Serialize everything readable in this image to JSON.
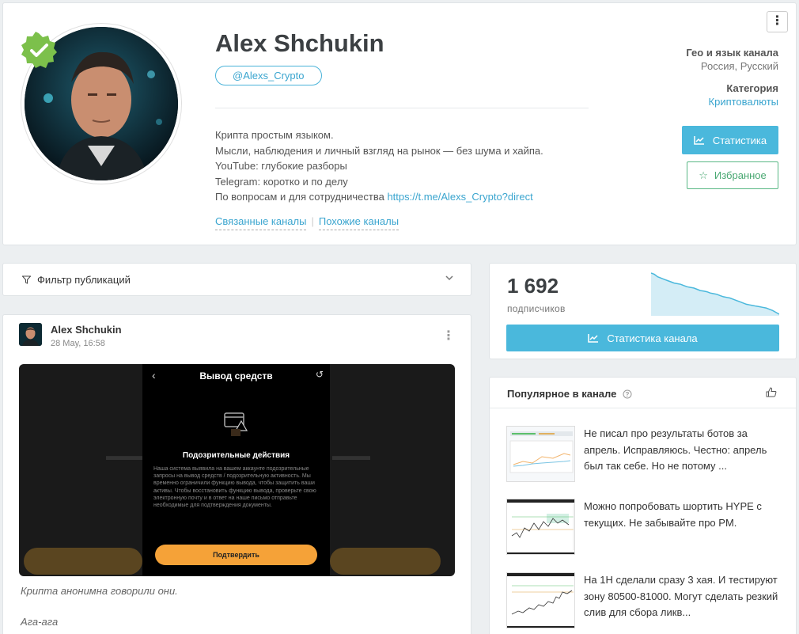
{
  "channel": {
    "name": "Alex Shchukin",
    "handle": "@Alexs_Crypto",
    "description": [
      "Крипта простым языком.",
      "Мысли, наблюдения и личный взгляд на рынок — без шума и хайпа.",
      "YouTube: глубокие разборы",
      "Telegram: коротко и по делу"
    ],
    "contact_text": "По вопросам и для сотрудничества",
    "contact_link": "https://t.me/Alexs_Crypto?direct",
    "related_link": "Связанные каналы",
    "similar_link": "Похожие каналы",
    "menu_icon": "⋮"
  },
  "meta": {
    "geo_label": "Гео и язык канала",
    "geo_value": "Россия, Русский",
    "category_label": "Категория",
    "category_value": "Криптовалюты",
    "stats_button": "Статистика",
    "favorite_button": "Избранное"
  },
  "filter": {
    "label": "Фильтр публикаций"
  },
  "post": {
    "author": "Alex Shchukin",
    "date": "28 May, 16:58",
    "caption": "Крипта анонимна говорили они.",
    "caption2": "Ага-ага",
    "screenshot": {
      "title": "Вывод средств",
      "heading": "Подозрительные действия",
      "body": "Наша система выявила на вашем аккаунте подозрительные запросы на вывод средств / подозрительную активность. Мы временно ограничили функцию вывода, чтобы защитить ваши активы. Чтобы восстановить функцию вывода, проверьте свою электронную почту и в ответ на наше письмо отправьте необходимые для подтверждения документы.",
      "button": "Подтвердить"
    }
  },
  "stats": {
    "subscribers": "1 692",
    "subscribers_label": "подписчиков",
    "button": "Статистика канала",
    "sparkline": [
      100,
      99,
      97,
      96,
      95,
      94,
      93,
      92,
      91.5,
      91,
      90,
      89,
      88.5,
      88,
      87,
      86,
      85.5,
      85,
      84,
      83.5,
      83,
      82,
      81,
      80.5,
      80,
      79,
      78,
      77,
      76,
      75,
      74.5,
      74,
      73.5,
      73,
      72.5,
      72,
      71,
      70,
      68.5,
      67
    ]
  },
  "popular": {
    "title": "Популярное в канале",
    "items": [
      {
        "text": "Не писал про результаты ботов за апрель. Исправляюсь. Честно: апрель был так себе. Но не потому ..."
      },
      {
        "text": "Можно попробовать шортить HYPE с текущих. Не забывайте про PM."
      },
      {
        "text": "На 1Н сделали сразу 3 хая. И тестируют зону 80500-81000. Могут сделать резкий слив для сбора ликв..."
      }
    ]
  },
  "colors": {
    "accent": "#4ab8dc",
    "favorite": "#59b885",
    "verified": "#7cc04b",
    "warning": "#f5a238"
  }
}
